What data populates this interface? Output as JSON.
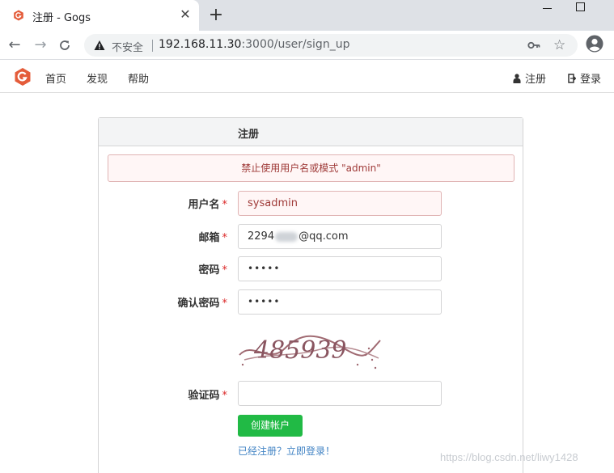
{
  "browser": {
    "tab_title": "注册 - Gogs",
    "tab_close": "✕",
    "new_tab": "+",
    "security_label": "不安全",
    "url_host": "192.168.11.30",
    "url_rest": ":3000/user/sign_up",
    "back_glyph": "←",
    "forward_glyph": "→",
    "reload_glyph": "C",
    "star_glyph": "☆"
  },
  "navbar": {
    "items": [
      "首页",
      "发现",
      "帮助"
    ],
    "register": "注册",
    "login": "登录"
  },
  "form": {
    "title": "注册",
    "error": "禁止使用用户名或模式 \"admin\"",
    "required_mark": "*",
    "username_label": "用户名",
    "username_value": "sysadmin",
    "email_label": "邮箱",
    "email_prefix": "2294",
    "email_suffix": "@qq.com",
    "password_label": "密码",
    "password_value": "•••••",
    "confirm_label": "确认密码",
    "confirm_value": "•••••",
    "captcha_text": "485939",
    "captcha_label": "验证码",
    "captcha_value": "",
    "submit": "创建帐户",
    "signin_link": "已经注册？立即登录！"
  },
  "watermark": "https://blog.csdn.net/liwy1428",
  "colors": {
    "accent_green": "#21ba45",
    "error_red": "#9f3a38",
    "link_blue": "#4183c4",
    "gogs_orange": "#e45c3a"
  }
}
